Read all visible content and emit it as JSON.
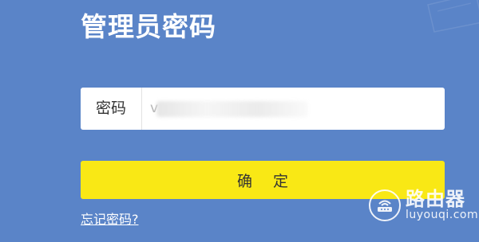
{
  "page": {
    "title": "管理员密码"
  },
  "password_field": {
    "label": "密码",
    "value": "v"
  },
  "confirm_button": {
    "label": "确定"
  },
  "forgot_link": {
    "label": "忘记密码?"
  },
  "watermark": {
    "name": "路由器",
    "domain": "luyouqi.com",
    "icon": "router-icon"
  },
  "colors": {
    "background": "#5a84c8",
    "button": "#f9e815",
    "text_light": "#ffffff"
  }
}
